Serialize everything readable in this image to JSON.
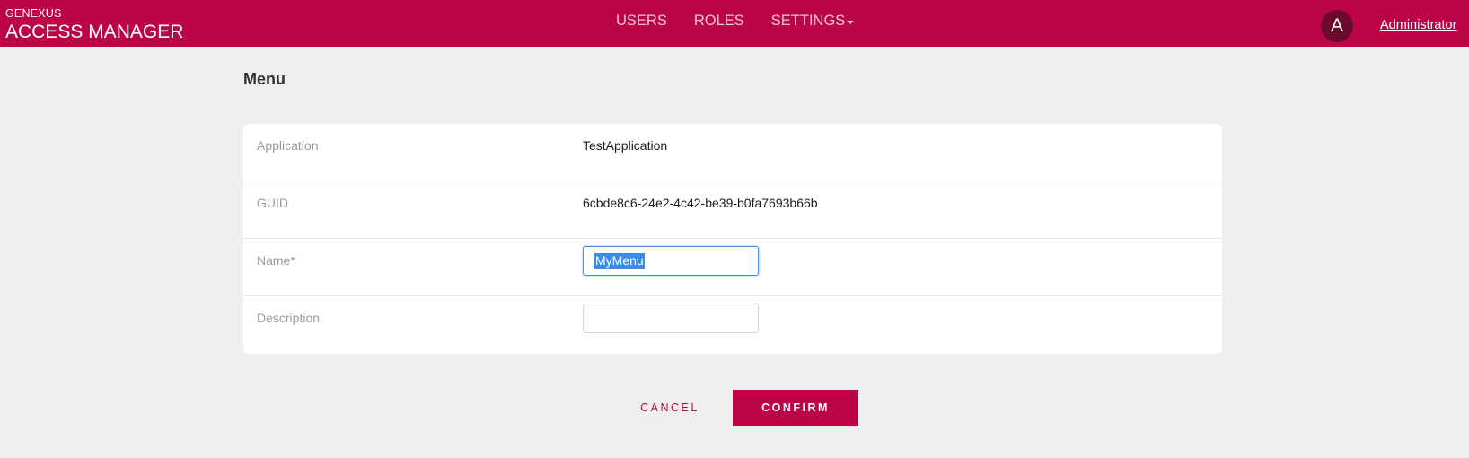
{
  "header": {
    "brand_small": "GENEXUS",
    "brand_large": "ACCESS MANAGER",
    "nav": {
      "users": "USERS",
      "roles": "ROLES",
      "settings": "SETTINGS"
    },
    "avatar_initial": "A",
    "user_name": "Administrator"
  },
  "page": {
    "title": "Menu"
  },
  "form": {
    "application": {
      "label": "Application",
      "value": "TestApplication"
    },
    "guid": {
      "label": "GUID",
      "value": "6cbde8c6-24e2-4c42-be39-b0fa7693b66b"
    },
    "name": {
      "label": "Name*",
      "value": "MyMenu"
    },
    "description": {
      "label": "Description",
      "value": ""
    }
  },
  "actions": {
    "cancel_label": "CANCEL",
    "confirm_label": "CONFIRM"
  },
  "colors": {
    "brand": "#bb0547",
    "background": "#efefef",
    "avatar": "#6b0a2c",
    "selection": "#3a8ce8"
  }
}
